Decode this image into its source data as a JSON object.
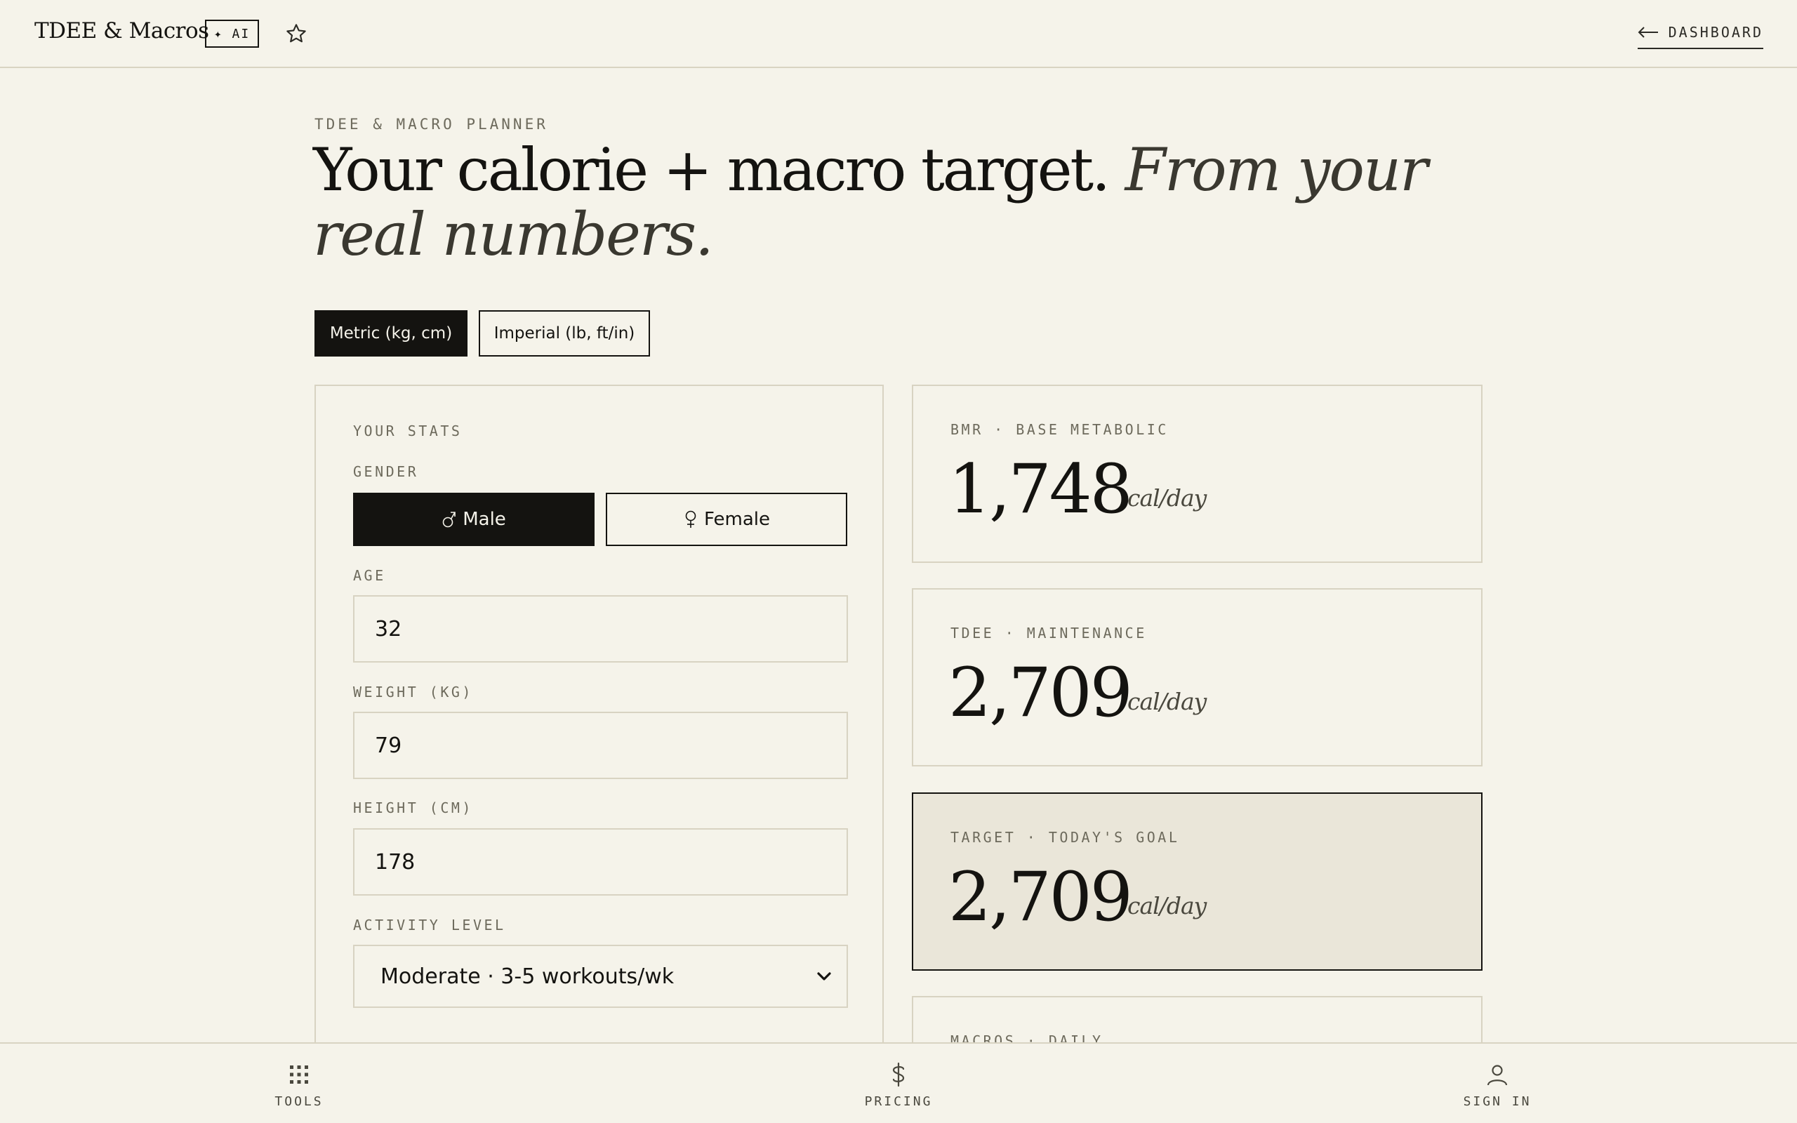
{
  "header": {
    "brand": "TDEE & Macros",
    "ai_badge": "✦ AI",
    "dashboard_link": "DASHBOARD"
  },
  "hero": {
    "eyebrow": "TDEE & MACRO PLANNER",
    "headline_main": "Your calorie + macro target.",
    "headline_italic": "From your real numbers."
  },
  "units": {
    "metric_label": "Metric (kg, cm)",
    "imperial_label": "Imperial (lb, ft/in)",
    "selected": "metric"
  },
  "stats": {
    "section_label": "YOUR STATS",
    "gender_label": "GENDER",
    "male_label": "Male",
    "female_label": "Female",
    "selected_gender": "male",
    "age_label": "AGE",
    "age_value": "32",
    "weight_label": "WEIGHT (KG)",
    "weight_value": "79",
    "height_label": "HEIGHT (CM)",
    "height_value": "178",
    "activity_label": "ACTIVITY LEVEL",
    "activity_value": "Moderate · 3-5 workouts/wk"
  },
  "results": [
    {
      "label": "BMR · BASE METABOLIC",
      "value": "1,748",
      "unit": "cal/day"
    },
    {
      "label": "TDEE · MAINTENANCE",
      "value": "2,709",
      "unit": "cal/day"
    },
    {
      "label": "TARGET · TODAY'S GOAL",
      "value": "2,709",
      "unit": "cal/day"
    },
    {
      "label": "MACROS · DAILY"
    }
  ],
  "bottom_nav": {
    "tools": "TOOLS",
    "pricing": "PRICING",
    "sign_in": "SIGN IN"
  },
  "colors": {
    "background": "#f5f3ea",
    "ink": "#141310",
    "muted": "#6d6a5c",
    "border": "#d8d3c2",
    "highlight_card": "#eae6d9"
  }
}
